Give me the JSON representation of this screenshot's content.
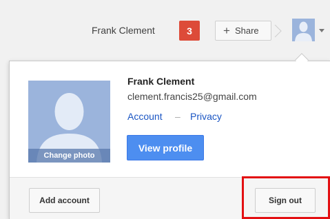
{
  "header": {
    "user_name": "Frank Clement",
    "notification_count": "3",
    "share_label": "Share",
    "share_icon": "plus-icon"
  },
  "profile": {
    "name": "Frank Clement",
    "email": "clement.francis25@gmail.com",
    "account_link": "Account",
    "separator": "–",
    "privacy_link": "Privacy",
    "change_photo_label": "Change photo",
    "view_profile_label": "View profile",
    "avatar_icon": "person-silhouette-icon"
  },
  "footer": {
    "add_account_label": "Add account",
    "sign_out_label": "Sign out"
  },
  "colors": {
    "notification_badge": "#dd4b39",
    "primary_button": "#4d8ef0",
    "link": "#1a55c3",
    "highlight_box": "#e30f12",
    "avatar_bg": "#9bb4dc"
  }
}
